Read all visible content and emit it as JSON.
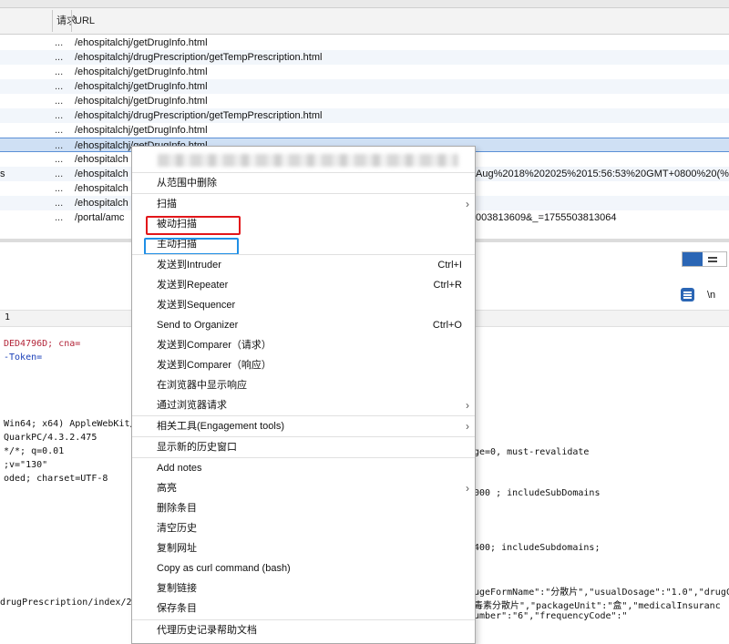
{
  "table": {
    "col_method": "请求",
    "col_url": "URL",
    "rows": [
      {
        "dots": "...",
        "url": "/ehospitalchj/getDrugInfo.html",
        "extra": ""
      },
      {
        "dots": "...",
        "url": "/ehospitalchj/drugPrescription/getTempPrescription.html",
        "extra": ""
      },
      {
        "dots": "...",
        "url": "/ehospitalchj/getDrugInfo.html",
        "extra": ""
      },
      {
        "dots": "...",
        "url": "/ehospitalchj/getDrugInfo.html",
        "extra": ""
      },
      {
        "dots": "...",
        "url": "/ehospitalchj/getDrugInfo.html",
        "extra": ""
      },
      {
        "dots": "...",
        "url": "/ehospitalchj/drugPrescription/getTempPrescription.html",
        "extra": ""
      },
      {
        "dots": "...",
        "url": "/ehospitalchj/getDrugInfo.html",
        "extra": ""
      },
      {
        "dots": "...",
        "url": "/ehospitalchj/getDrugInfo.html",
        "extra": ""
      },
      {
        "dots": "...",
        "url": "/ehospitalch",
        "extra": ""
      },
      {
        "dots": "...",
        "url": "/ehospitalch",
        "extra": "Aug%2018%202025%2015:56:53%20GMT+0800%20(%E"
      },
      {
        "dots": "...",
        "url": "/ehospitalch",
        "extra": ""
      },
      {
        "dots": "...",
        "url": "/ehospitalch",
        "extra": ""
      },
      {
        "dots": "...",
        "url": "/portal/amc",
        "extra": "003813609&_=1755503813064"
      }
    ],
    "left_char": "s"
  },
  "request_pane": {
    "line_number": "1",
    "wrap_label": "\\n",
    "lines": [
      "DED4796D; cna=",
      "-Token=",
      "Win64; x64) AppleWebKit/",
      "QuarkPC/4.3.2.475",
      "*/*; q=0.01",
      ";v=\"130\"",
      "oded; charset=UTF-8",
      "drugPrescription/index/2"
    ],
    "right_lines": [
      "ge=0, must-revalidate",
      "000 ; includeSubDomains",
      "400; includeSubdomains;",
      "ugeFormName\":\"分散片\",\"usualDosage\":\"1.0\",\"drugC",
      "毒素分散片\",\"packageUnit\":\"盒\",\"medicalInsuranc",
      "umber\":\"6\",\"frequencyCode\":\""
    ]
  },
  "context_menu": {
    "items": [
      {
        "label": "从范围中删除"
      },
      {
        "label": "扫描",
        "submenu": true
      },
      {
        "label": "被动扫描"
      },
      {
        "label": "主动扫描"
      },
      {
        "label": "发送到Intruder",
        "shortcut": "Ctrl+I"
      },
      {
        "label": "发送到Repeater",
        "shortcut": "Ctrl+R"
      },
      {
        "label": "发送到Sequencer"
      },
      {
        "label": "Send to Organizer",
        "shortcut": "Ctrl+O"
      },
      {
        "label": "发送到Comparer（请求）"
      },
      {
        "label": "发送到Comparer（响应）"
      },
      {
        "label": "在浏览器中显示响应"
      },
      {
        "label": "通过浏览器请求",
        "submenu": true
      },
      {
        "label": "相关工具(Engagement tools)",
        "submenu": true
      },
      {
        "label": "显示新的历史窗口"
      },
      {
        "label": "Add notes"
      },
      {
        "label": "高亮",
        "submenu": true
      },
      {
        "label": "删除条目"
      },
      {
        "label": "清空历史"
      },
      {
        "label": "复制网址"
      },
      {
        "label": "Copy as curl command (bash)"
      },
      {
        "label": "复制链接"
      },
      {
        "label": "保存条目"
      },
      {
        "label": "代理历史记录帮助文档"
      }
    ]
  },
  "colors": {
    "selected_row": "#cfe0f4",
    "highlight_red": "#e2161a",
    "highlight_blue": "#1f8fe6",
    "accent": "#2b66b5"
  }
}
